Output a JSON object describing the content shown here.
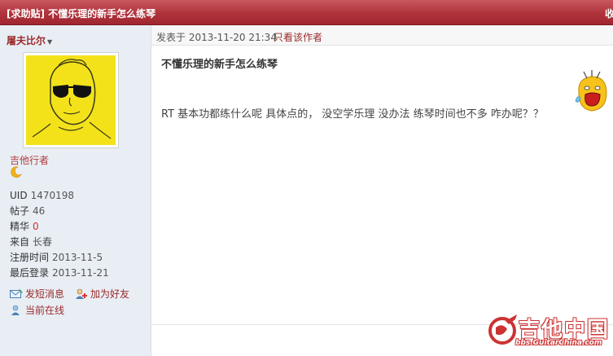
{
  "thread": {
    "title": "[求助贴] 不懂乐理的新手怎么练琴",
    "collapse_glyph": "收"
  },
  "sidebar": {
    "username": "屠夫比尔",
    "usergroup": "吉他行者",
    "rank_icon": "moon-icon",
    "stats": [
      {
        "label": "UID",
        "value": "1470198"
      },
      {
        "label": "帖子",
        "value": "46"
      },
      {
        "label": "精华",
        "value": "0"
      },
      {
        "label": "来自",
        "value": "长春"
      },
      {
        "label": "注册时间",
        "value": "2013-11-5"
      },
      {
        "label": "最后登录",
        "value": "2013-11-21"
      }
    ],
    "actions": {
      "message": "发短消息",
      "add_friend": "加为好友",
      "online": "当前在线"
    }
  },
  "post": {
    "posted_at": "发表于 2013-11-20 21:34",
    "only_author": "只看该作者",
    "title": "不懂乐理的新手怎么练琴",
    "body": "RT 基本功都练什么呢 具体点的， 没空学乐理 没办法 练琴时间也不多 咋办呢？？"
  },
  "watermark": {
    "brand": "吉他中国",
    "url": "bbs.GuitarChina.com"
  },
  "colors": {
    "titlebar": "#b0333c",
    "sidebar_bg": "#e8eef4",
    "accent_red": "#9b2a2a"
  }
}
